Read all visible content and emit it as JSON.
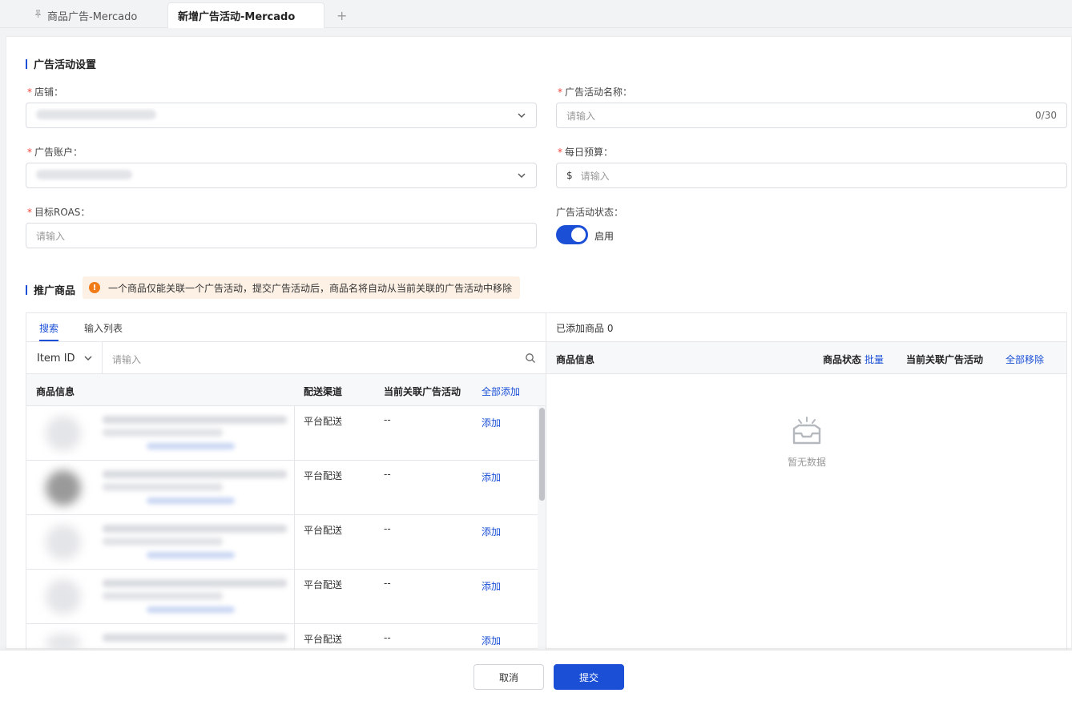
{
  "tabs": {
    "items": [
      {
        "label": "商品广告-Mercado"
      },
      {
        "label": "新增广告活动-Mercado"
      }
    ],
    "add_label": "+"
  },
  "settings": {
    "title": "广告活动设置",
    "shop": {
      "label": "店铺："
    },
    "campaign_name": {
      "label": "广告活动名称：",
      "placeholder": "请输入",
      "counter": "0/30"
    },
    "ad_account": {
      "label": "广告账户："
    },
    "daily_budget": {
      "label": "每日预算：",
      "currency": "$",
      "placeholder": "请输入"
    },
    "target_roas": {
      "label": "目标ROAS：",
      "placeholder": "请输入"
    },
    "status": {
      "label": "广告活动状态：",
      "value": "启用",
      "enabled": true
    }
  },
  "promo": {
    "title": "推广商品",
    "notice": "一个商品仅能关联一个广告活动，提交广告活动后，商品名将自动从当前关联的广告活动中移除",
    "left": {
      "tabs": [
        "搜索",
        "输入列表"
      ],
      "search_field": "Item ID",
      "search_placeholder": "请输入",
      "columns": {
        "product": "商品信息",
        "shipping": "配送渠道",
        "campaign": "当前关联广告活动",
        "add_all": "全部添加"
      },
      "rows": [
        {
          "shipping": "平台配送",
          "campaign": "--",
          "action": "添加"
        },
        {
          "shipping": "平台配送",
          "campaign": "--",
          "action": "添加"
        },
        {
          "shipping": "平台配送",
          "campaign": "--",
          "action": "添加"
        },
        {
          "shipping": "平台配送",
          "campaign": "--",
          "action": "添加"
        },
        {
          "shipping": "平台配送",
          "campaign": "--",
          "action": "添加"
        }
      ]
    },
    "right": {
      "added_label": "已添加商品 0",
      "columns": {
        "product": "商品信息",
        "status": "商品状态",
        "batch": "批量",
        "campaign": "当前关联广告活动",
        "remove_all": "全部移除"
      },
      "empty_text": "暂无数据"
    }
  },
  "footer": {
    "cancel": "取消",
    "submit": "提交"
  },
  "colors": {
    "primary": "#1a4fd6",
    "required": "#f04438",
    "warning_bg": "#fdf1e6",
    "warning_icon": "#f07b17"
  }
}
